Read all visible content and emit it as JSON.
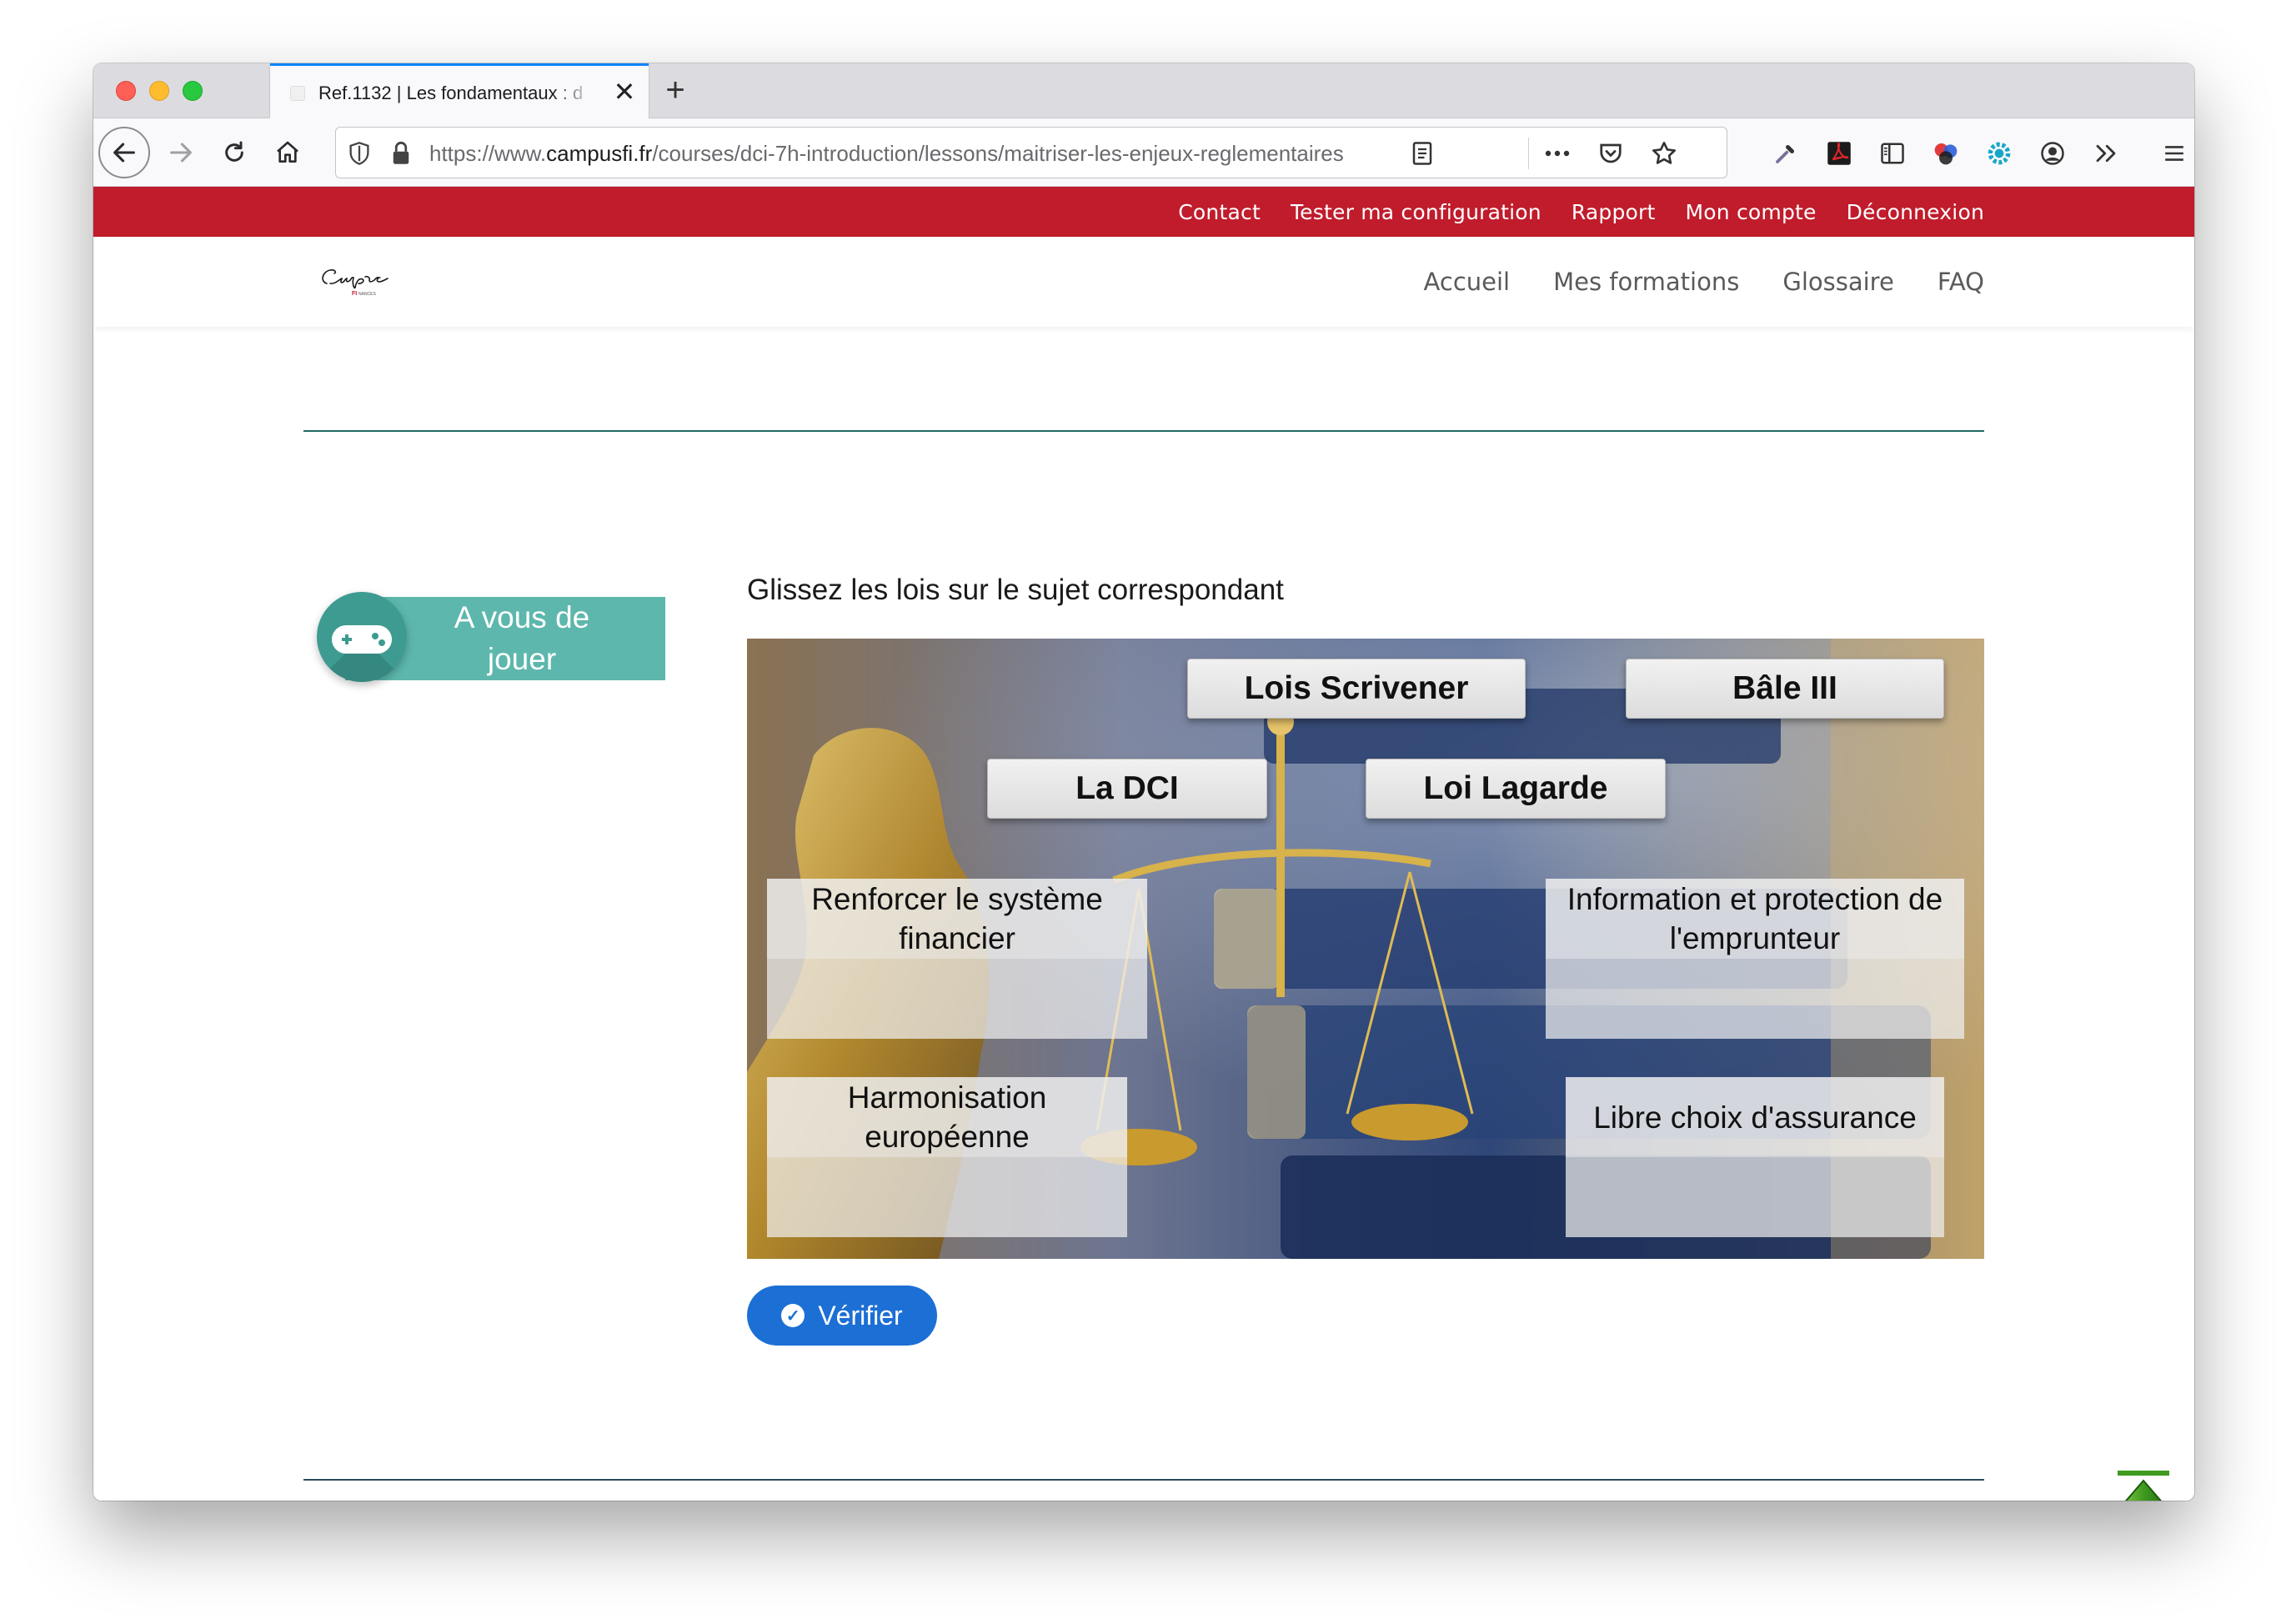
{
  "browser": {
    "tab_title": "Ref.1132 | Les fondamentaux : d",
    "close_glyph": "✕",
    "new_tab_glyph": "+",
    "url_prefix": "https://www.",
    "url_host": "campusfi.fr",
    "url_path": "/courses/dci-7h-introduction/lessons/maitriser-les-enjeux-reglementaires"
  },
  "topbar": {
    "links": [
      "Contact",
      "Tester ma configuration",
      "Rapport",
      "Mon compte",
      "Déconnexion"
    ]
  },
  "nav": {
    "items": [
      "Accueil",
      "Mes formations",
      "Glossaire",
      "FAQ"
    ]
  },
  "badge": {
    "text": "A vous de jouer"
  },
  "exercise": {
    "instruction": "Glissez les lois sur le sujet correspondant",
    "draggables": [
      "Lois Scrivener",
      "Bâle III",
      "La DCI",
      "Loi Lagarde"
    ],
    "targets": [
      "Renforcer le système financier",
      "Information et protection de l'emprunteur",
      "Harmonisation européenne",
      "Libre choix d'assurance"
    ]
  },
  "verify_button": {
    "label": "Vérifier"
  },
  "colors": {
    "topbar": "#c01c2c",
    "accent_teal": "#5db7ad",
    "button_blue": "#1c6fd4",
    "divider": "#1f6b63"
  }
}
